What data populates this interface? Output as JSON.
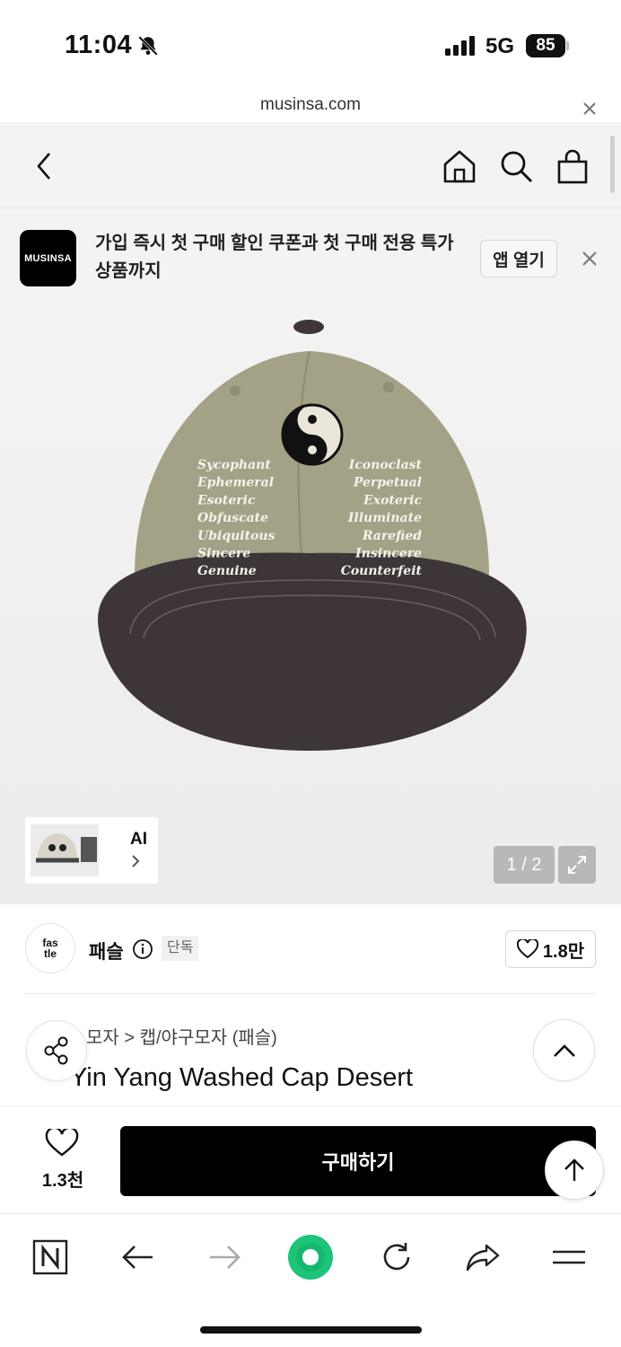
{
  "status_bar": {
    "time": "11:04",
    "network": "5G",
    "battery": "85",
    "icons": [
      "bell-slash-icon",
      "signal-icon"
    ]
  },
  "url_bar": {
    "url": "musinsa.com",
    "close_icon": "close-icon"
  },
  "header": {
    "icons": [
      "back-icon",
      "home-icon",
      "search-icon",
      "shopping-bag-icon"
    ]
  },
  "promo": {
    "logo_text": "MUSINSA",
    "message": "가입 즉시 첫 구매 할인 쿠폰과 첫 구매 전용 특가 상품까지",
    "open_app_label": "앱 열기"
  },
  "product_image": {
    "thumbnail_label": "AI",
    "counter": "1 / 2",
    "embroidery_left": [
      "Sycophant",
      "Ephemeral",
      "Esoteric",
      "Obfuscate",
      "Ubiquitous",
      "Sincere",
      "Genuine"
    ],
    "embroidery_right": [
      "Iconoclast",
      "Perpetual",
      "Exoteric",
      "Illuminate",
      "Rarefied",
      "Insincere",
      "Counterfeit"
    ],
    "colors": {
      "crown": "#a3a186",
      "brim": "#3e3538"
    }
  },
  "brand": {
    "logo_text": "fas\ntle",
    "name": "패슬",
    "badge": "단독",
    "likes": "1.8만"
  },
  "product": {
    "breadcrumb": "모자 > 캡/야구모자 (패슬)",
    "title": "Yin Yang Washed Cap Desert"
  },
  "buy_bar": {
    "wish_count": "1.3천",
    "buy_label": "구매하기"
  },
  "browser_toolbar": {
    "icons": [
      "naver-icon",
      "back-arrow-icon",
      "forward-arrow-icon",
      "green-dot-icon",
      "refresh-icon",
      "share-icon",
      "menu-icon"
    ]
  }
}
